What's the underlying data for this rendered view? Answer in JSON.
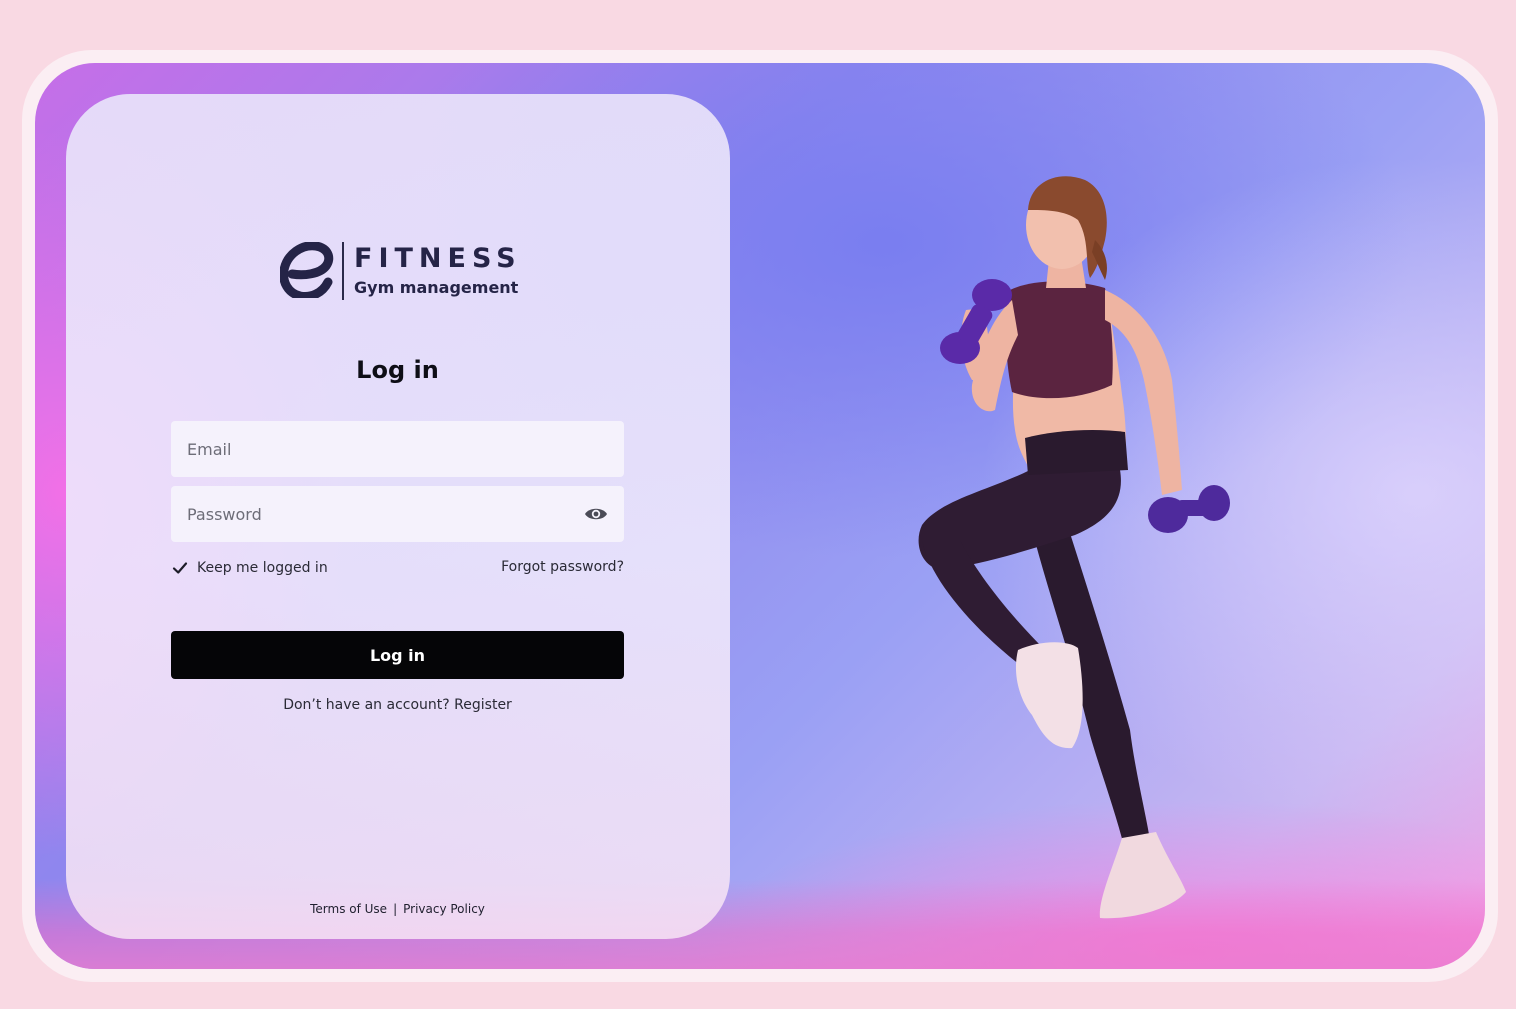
{
  "brand": {
    "name": "FITNESS",
    "subtitle": "Gym management",
    "logo_icon": "e-logo-icon"
  },
  "login": {
    "title": "Log in",
    "email_placeholder": "Email",
    "password_placeholder": "Password",
    "password_toggle_icon": "eye-icon",
    "keep_logged_in_label": "Keep me logged in",
    "keep_logged_in_checked": true,
    "forgot_password_label": "Forgot password?",
    "submit_label": "Log in",
    "register_prompt": "Don’t have an account?",
    "register_link": "Register"
  },
  "footer": {
    "terms_label": "Terms of Use",
    "separator": "|",
    "privacy_label": "Privacy Policy"
  },
  "colors": {
    "page_background": "#f9d9e3",
    "button_background": "#050507",
    "brand_text": "#252447"
  }
}
